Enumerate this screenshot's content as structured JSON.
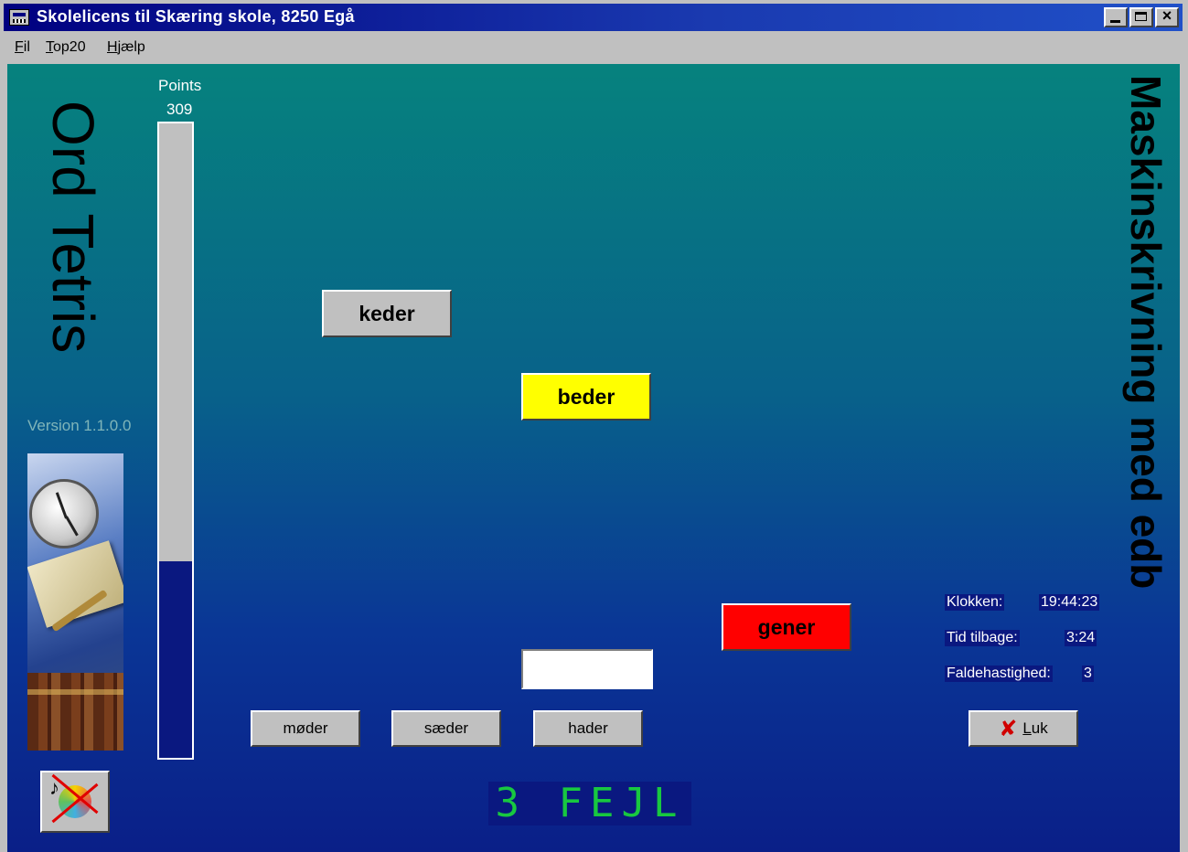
{
  "window": {
    "title": "Skolelicens til  Skæring skole,  8250  Egå"
  },
  "menu": {
    "items": [
      {
        "label": "Fil",
        "accel": "F",
        "rest": "il"
      },
      {
        "label": "Top20",
        "accel": "T",
        "rest": "op20"
      },
      {
        "label": "Hjælp",
        "accel": "H",
        "rest": "jælp"
      }
    ]
  },
  "app": {
    "name": "Ord Tetris",
    "version": "Version 1.1.0.0",
    "subtitle": "Maskinskrivning med edb"
  },
  "score": {
    "label": "Points",
    "value": "309",
    "fill_fraction": 0.31
  },
  "blocks": [
    {
      "word": "keder",
      "color": "#c0c0c0"
    },
    {
      "word": "beder",
      "color": "#ffff00"
    },
    {
      "word": "gener",
      "color": "#ff0000"
    }
  ],
  "answer_input": {
    "value": ""
  },
  "choices": [
    "møder",
    "sæder",
    "hader"
  ],
  "info": {
    "clock_label": "Klokken:",
    "clock_value": "19:44:23",
    "time_left_label": "Tid tilbage:",
    "time_left_value": "3:24",
    "speed_label": "Faldehastighed:",
    "speed_value": "3"
  },
  "close_button": {
    "label": "Luk",
    "accel": "L",
    "rest": "uk"
  },
  "errors_display": "3 FEJL"
}
